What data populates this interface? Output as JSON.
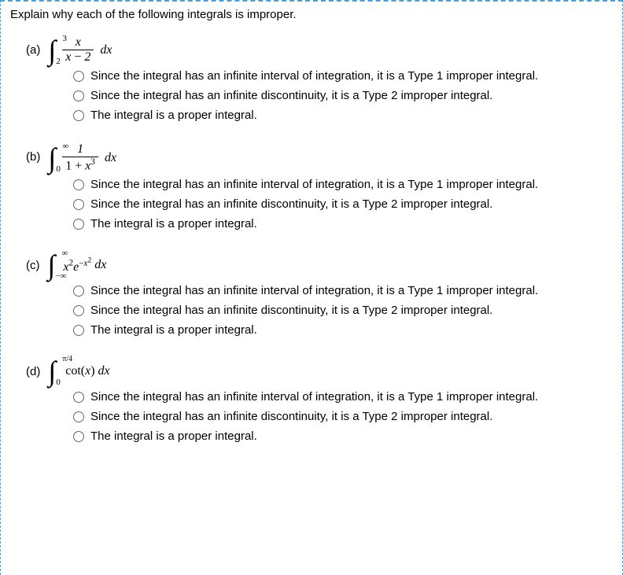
{
  "prompt": "Explain why each of the following integrals is improper.",
  "questions": {
    "a": {
      "label": "(a)",
      "upper": "3",
      "lower": "2",
      "num": "x",
      "den_left": "x",
      "den_mid": " − ",
      "den_right": "2",
      "dx": "dx"
    },
    "b": {
      "label": "(b)",
      "upper": "∞",
      "lower": "0",
      "num": "1",
      "den_left": "1 + ",
      "den_var": "x",
      "den_exp": "3",
      "dx": "dx"
    },
    "c": {
      "label": "(c)",
      "upper": "∞",
      "lower": "−∞",
      "var1": "x",
      "exp1": "2",
      "e": "e",
      "exp2_pre": "−",
      "exp2_var": "x",
      "exp2_pow": "2",
      "dx": "dx"
    },
    "d": {
      "label": "(d)",
      "upper": "π/4",
      "lower": "0",
      "fn": "cot(",
      "var": "x",
      "paren": ") ",
      "dx": "dx"
    }
  },
  "options": {
    "opt1": "Since the integral has an infinite interval of integration, it is a Type 1 improper integral.",
    "opt2": "Since the integral has an infinite discontinuity, it is a Type 2 improper integral.",
    "opt3": "The integral is a proper integral."
  }
}
